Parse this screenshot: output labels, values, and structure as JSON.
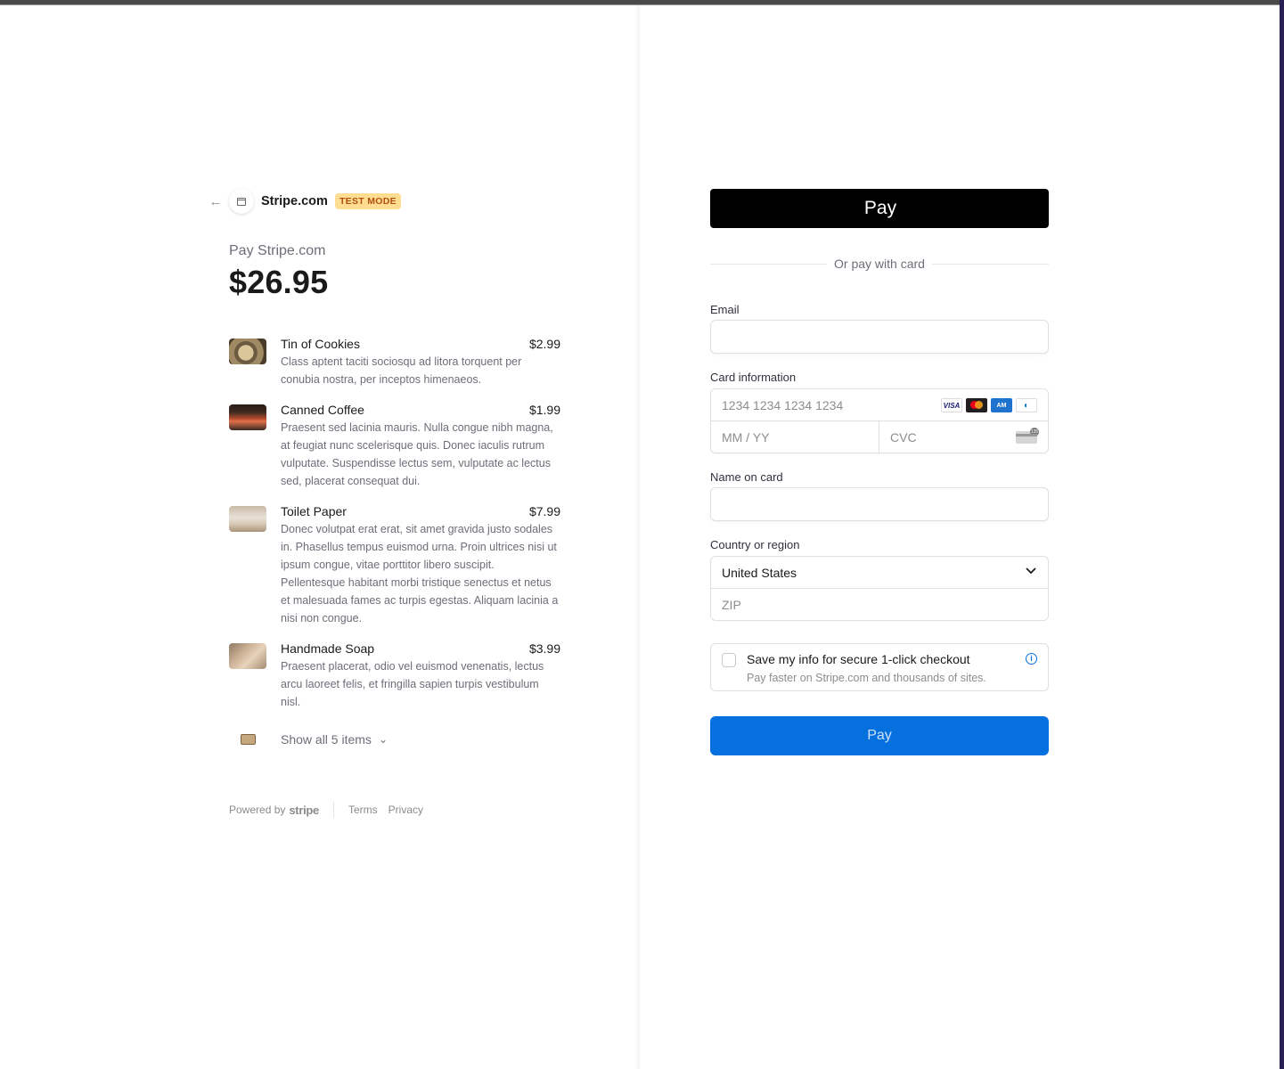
{
  "merchant": {
    "name": "Stripe.com",
    "test_badge": "TEST MODE",
    "pay_label": "Pay Stripe.com",
    "amount": "$26.95"
  },
  "items": [
    {
      "name": "Tin of Cookies",
      "price": "$2.99",
      "desc": "Class aptent taciti sociosqu ad litora torquent per conubia nostra, per inceptos himenaeos.",
      "thumb": "cookies-image"
    },
    {
      "name": "Canned Coffee",
      "price": "$1.99",
      "desc": "Praesent sed lacinia mauris. Nulla congue nibh magna, at feugiat nunc scelerisque quis. Donec iaculis rutrum vulputate. Suspendisse lectus sem, vulputate ac lectus sed, placerat consequat dui.",
      "thumb": "coffee-image"
    },
    {
      "name": "Toilet Paper",
      "price": "$7.99",
      "desc": "Donec volutpat erat erat, sit amet gravida justo sodales in. Phasellus tempus euismod urna. Proin ultrices nisi ut ipsum congue, vitae porttitor libero suscipit. Pellentesque habitant morbi tristique senectus et netus et malesuada fames ac turpis egestas. Aliquam lacinia a nisi non congue.",
      "thumb": "toilet-paper-image"
    },
    {
      "name": "Handmade Soap",
      "price": "$3.99",
      "desc": "Praesent placerat, odio vel euismod venenatis, lectus arcu laoreet felis, et fringilla sapien turpis vestibulum nisl.",
      "thumb": "soap-image"
    }
  ],
  "show_all": "Show all 5 items",
  "footer": {
    "powered_by": "Powered by",
    "brand": "stripe",
    "terms": "Terms",
    "privacy": "Privacy"
  },
  "form": {
    "apple_pay_label": "Pay",
    "or_pay": "Or pay with card",
    "email_label": "Email",
    "email_value": "",
    "card_label": "Card information",
    "card_number_placeholder": "1234 1234 1234 1234",
    "expiry_placeholder": "MM / YY",
    "cvc_placeholder": "CVC",
    "name_label": "Name on card",
    "name_value": "",
    "country_label": "Country or region",
    "country_value": "United States",
    "zip_placeholder": "ZIP",
    "save_title": "Save my info for secure 1-click checkout",
    "save_sub": "Pay faster on Stripe.com and thousands of sites.",
    "pay_button": "Pay"
  },
  "card_brands": [
    "VISA",
    "mastercard",
    "amex",
    "diners"
  ],
  "colors": {
    "accent": "#0570de",
    "test_badge_bg": "#ffde92",
    "test_badge_text": "#b1500f",
    "apple_pay_bg": "#000000"
  }
}
